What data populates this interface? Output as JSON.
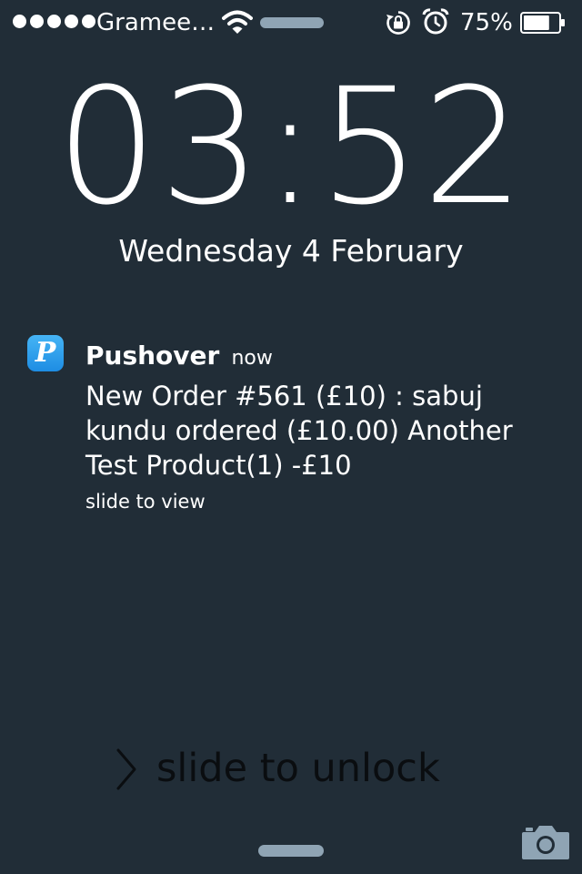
{
  "status_bar": {
    "signal_bars": 5,
    "carrier": "Gramee…",
    "battery_percent": "75%",
    "battery_level": 0.75,
    "icons": [
      "signal-dots-icon",
      "wifi-icon",
      "rotation-lock-icon",
      "alarm-icon",
      "battery-icon"
    ]
  },
  "clock": {
    "time": "03:52",
    "date": "Wednesday 4 February"
  },
  "notification": {
    "app_icon_letter": "P",
    "app_name": "Pushover",
    "time": "now",
    "message": "New Order #561 (£10) : sabuj kundu ordered (£10.00) Another Test Product(1) -£10",
    "hint": "slide to view"
  },
  "unlock": {
    "label": "slide to unlock"
  },
  "bottom": {
    "icons": [
      "grabber-handle",
      "camera-icon"
    ]
  },
  "colors": {
    "background": "#212d37",
    "accent_grey": "#8fa4b4",
    "app_icon_blue": "#1e8de3",
    "unlock_text": "#0a0d10"
  }
}
